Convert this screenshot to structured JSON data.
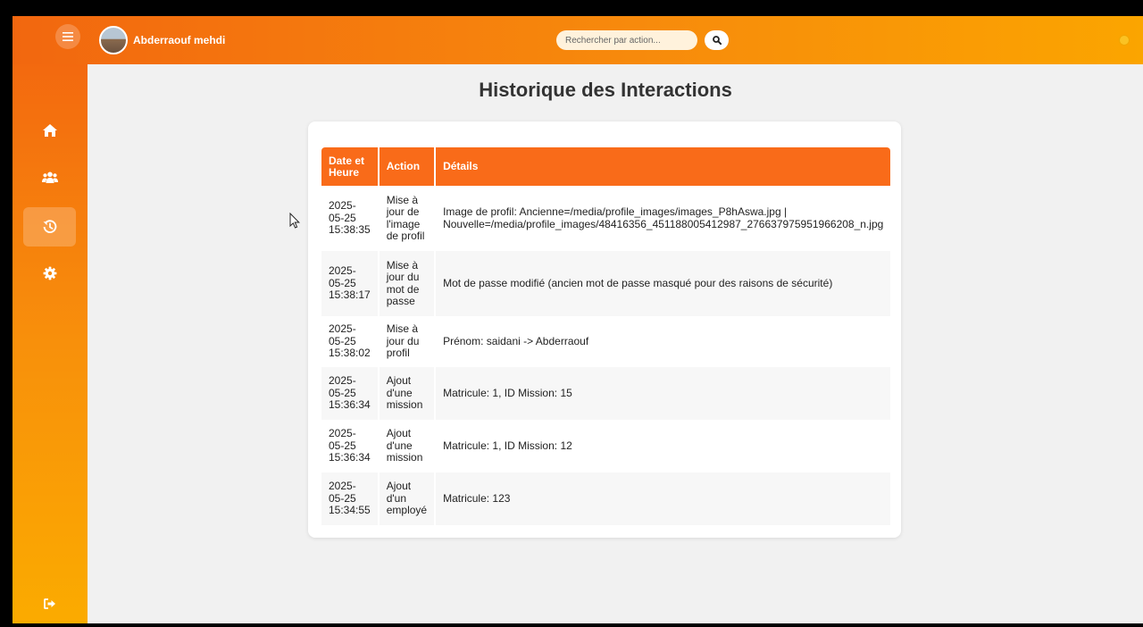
{
  "header": {
    "user_name": "Abderraouf mehdi",
    "search_placeholder": "Rechercher par action..."
  },
  "sidebar": {
    "items": [
      {
        "icon": "home-icon"
      },
      {
        "icon": "users-icon"
      },
      {
        "icon": "history-icon",
        "active": true
      },
      {
        "icon": "gear-icon"
      }
    ],
    "logout_icon": "logout-icon"
  },
  "main": {
    "title": "Historique des Interactions",
    "table": {
      "headers": [
        "Date et Heure",
        "Action",
        "Détails"
      ],
      "rows": [
        {
          "date": "2025-05-25 15:38:35",
          "action": "Mise à jour de l'image de profil",
          "details": "Image de profil: Ancienne=/media/profile_images/images_P8hAswa.jpg | Nouvelle=/media/profile_images/48416356_451188005412987_276637975951966208_n.jpg"
        },
        {
          "date": "2025-05-25 15:38:17",
          "action": "Mise à jour du mot de passe",
          "details": "Mot de passe modifié (ancien mot de passe masqué pour des raisons de sécurité)"
        },
        {
          "date": "2025-05-25 15:38:02",
          "action": "Mise à jour du profil",
          "details": "Prénom: saidani -> Abderraouf"
        },
        {
          "date": "2025-05-25 15:36:34",
          "action": "Ajout d'une mission",
          "details": "Matricule: 1, ID Mission: 15"
        },
        {
          "date": "2025-05-25 15:36:34",
          "action": "Ajout d'une mission",
          "details": "Matricule: 1, ID Mission: 12"
        },
        {
          "date": "2025-05-25 15:34:55",
          "action": "Ajout d'un employé",
          "details": "Matricule: 123"
        }
      ]
    }
  },
  "colors": {
    "accent": "#f96b19",
    "gradient_start": "#f2670f",
    "gradient_end": "#fba500"
  }
}
